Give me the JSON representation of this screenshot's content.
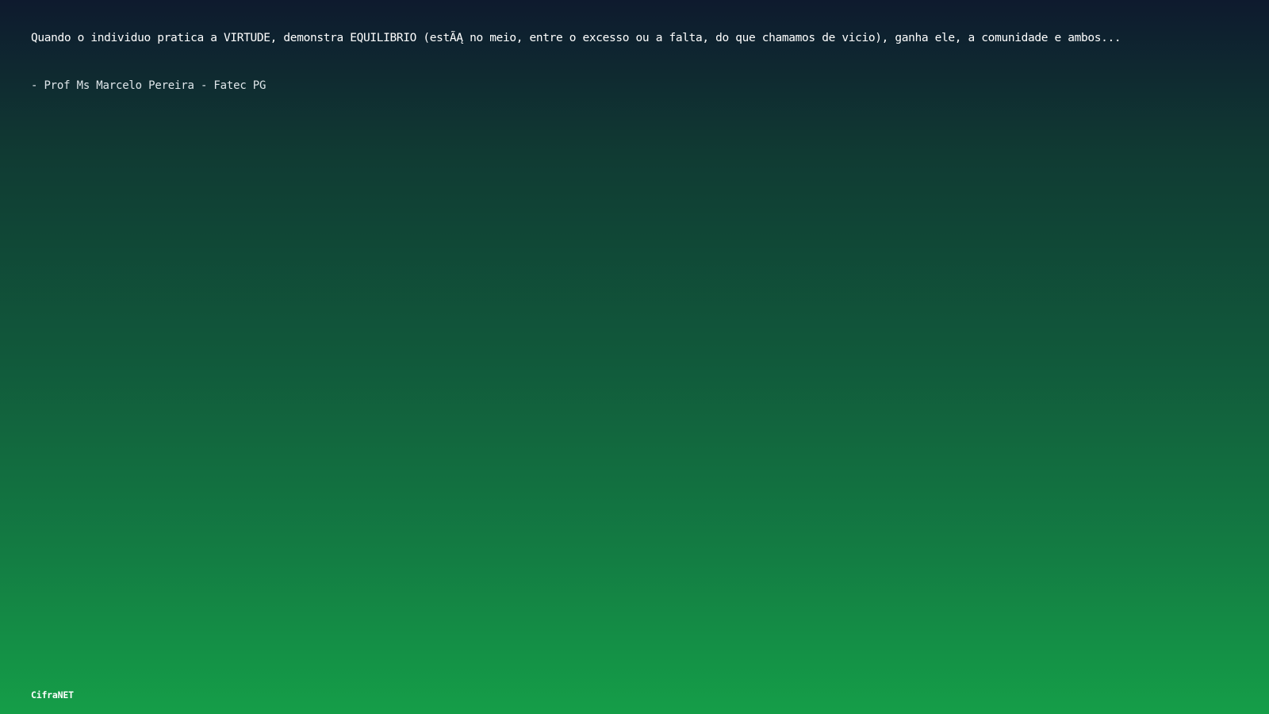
{
  "quote": {
    "text": "Quando o individuo pratica a VIRTUDE, demonstra EQUILIBRIO (estÃĄ no meio, entre o excesso ou a falta, do que chamamos de vicio), ganha ele, a comunidade e ambos...",
    "author": "- Prof Ms Marcelo Pereira - Fatec PG"
  },
  "brand": {
    "name": "CifraNET"
  },
  "colors": {
    "gradient_top": "#0e1a2e",
    "gradient_bottom": "#159e48",
    "text": "#ffffff"
  }
}
